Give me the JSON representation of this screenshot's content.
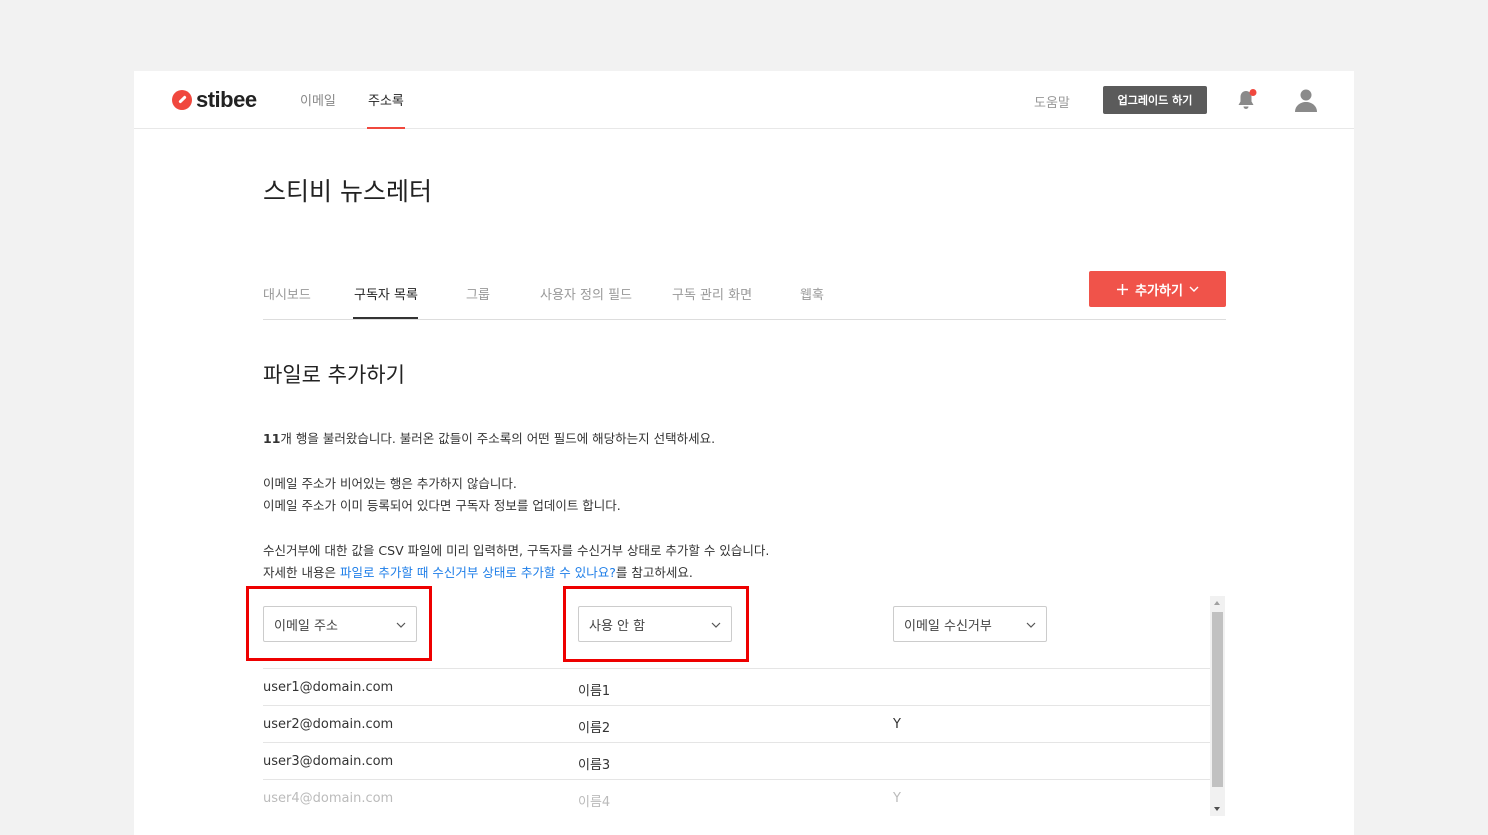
{
  "brand": {
    "name": "stibee",
    "accent": "#f0483e"
  },
  "topnav": {
    "email": "이메일",
    "addressbook": "주소록",
    "help": "도움말",
    "upgrade": "업그레이드 하기"
  },
  "page": {
    "title": "스티비 뉴스레터"
  },
  "tabs": [
    "대시보드",
    "구독자 목록",
    "그룹",
    "사용자 정의 필드",
    "구독 관리 화면",
    "웹훅"
  ],
  "add_button": "추가하기",
  "section": {
    "title": "파일로 추가하기",
    "count": "11",
    "line1_rest": "개 행을 불러왔습니다. 불러온 값들이 주소록의 어떤 필드에 해당하는지 선택하세요.",
    "line2": "이메일 주소가 비어있는 행은 추가하지 않습니다.",
    "line3": "이메일 주소가 이미 등록되어 있다면 구독자 정보를 업데이트 합니다.",
    "line4": "수신거부에 대한 값을 CSV 파일에 미리 입력하면, 구독자를 수신거부 상태로 추가할 수 있습니다.",
    "line5_pre": "자세한 내용은 ",
    "line5_link": "파일로 추가할 때 수신거부 상태로 추가할 수 있나요?",
    "line5_post": "를 참고하세요."
  },
  "mapping": {
    "col1": "이메일 주소",
    "col2": "사용 안 함",
    "col3": "이메일 수신거부"
  },
  "rows": [
    {
      "email": "user1@domain.com",
      "name": "이름1",
      "unsub": ""
    },
    {
      "email": "user2@domain.com",
      "name": "이름2",
      "unsub": "Y"
    },
    {
      "email": "user3@domain.com",
      "name": "이름3",
      "unsub": ""
    },
    {
      "email": "user4@domain.com",
      "name": "이름4",
      "unsub": "Y"
    }
  ]
}
